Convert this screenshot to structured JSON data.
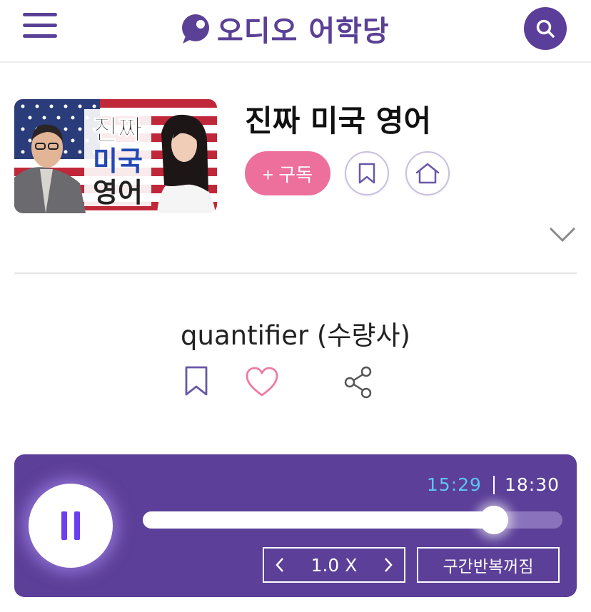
{
  "header": {
    "menu_icon": "hamburger-menu-icon",
    "logo_text": "오디오 어학당",
    "search_icon": "search-icon",
    "brand_color": "#5a4196"
  },
  "program": {
    "title": "진짜 미국 영어",
    "thumbnail_text": [
      "진짜",
      "미국",
      "영어"
    ],
    "subscribe_label": "+ 구독",
    "subscribe_color": "#ed6f9c",
    "bookmark_icon": "bookmark-icon",
    "home_icon": "home-icon",
    "expand_icon": "chevron-down-icon"
  },
  "episode": {
    "title": "quantifier (수량사)",
    "bookmark_icon": "bookmark-icon",
    "like_icon": "heart-icon",
    "share_icon": "share-icon"
  },
  "player": {
    "background": "#5c3f98",
    "state_icon": "pause-icon",
    "current_time": "15:29",
    "total_time": "18:30",
    "progress": 0.8369,
    "speed_label": "1.0 X",
    "speed_prev_icon": "chevron-left-icon",
    "speed_next_icon": "chevron-right-icon",
    "repeat_label": "구간반복꺼짐"
  }
}
